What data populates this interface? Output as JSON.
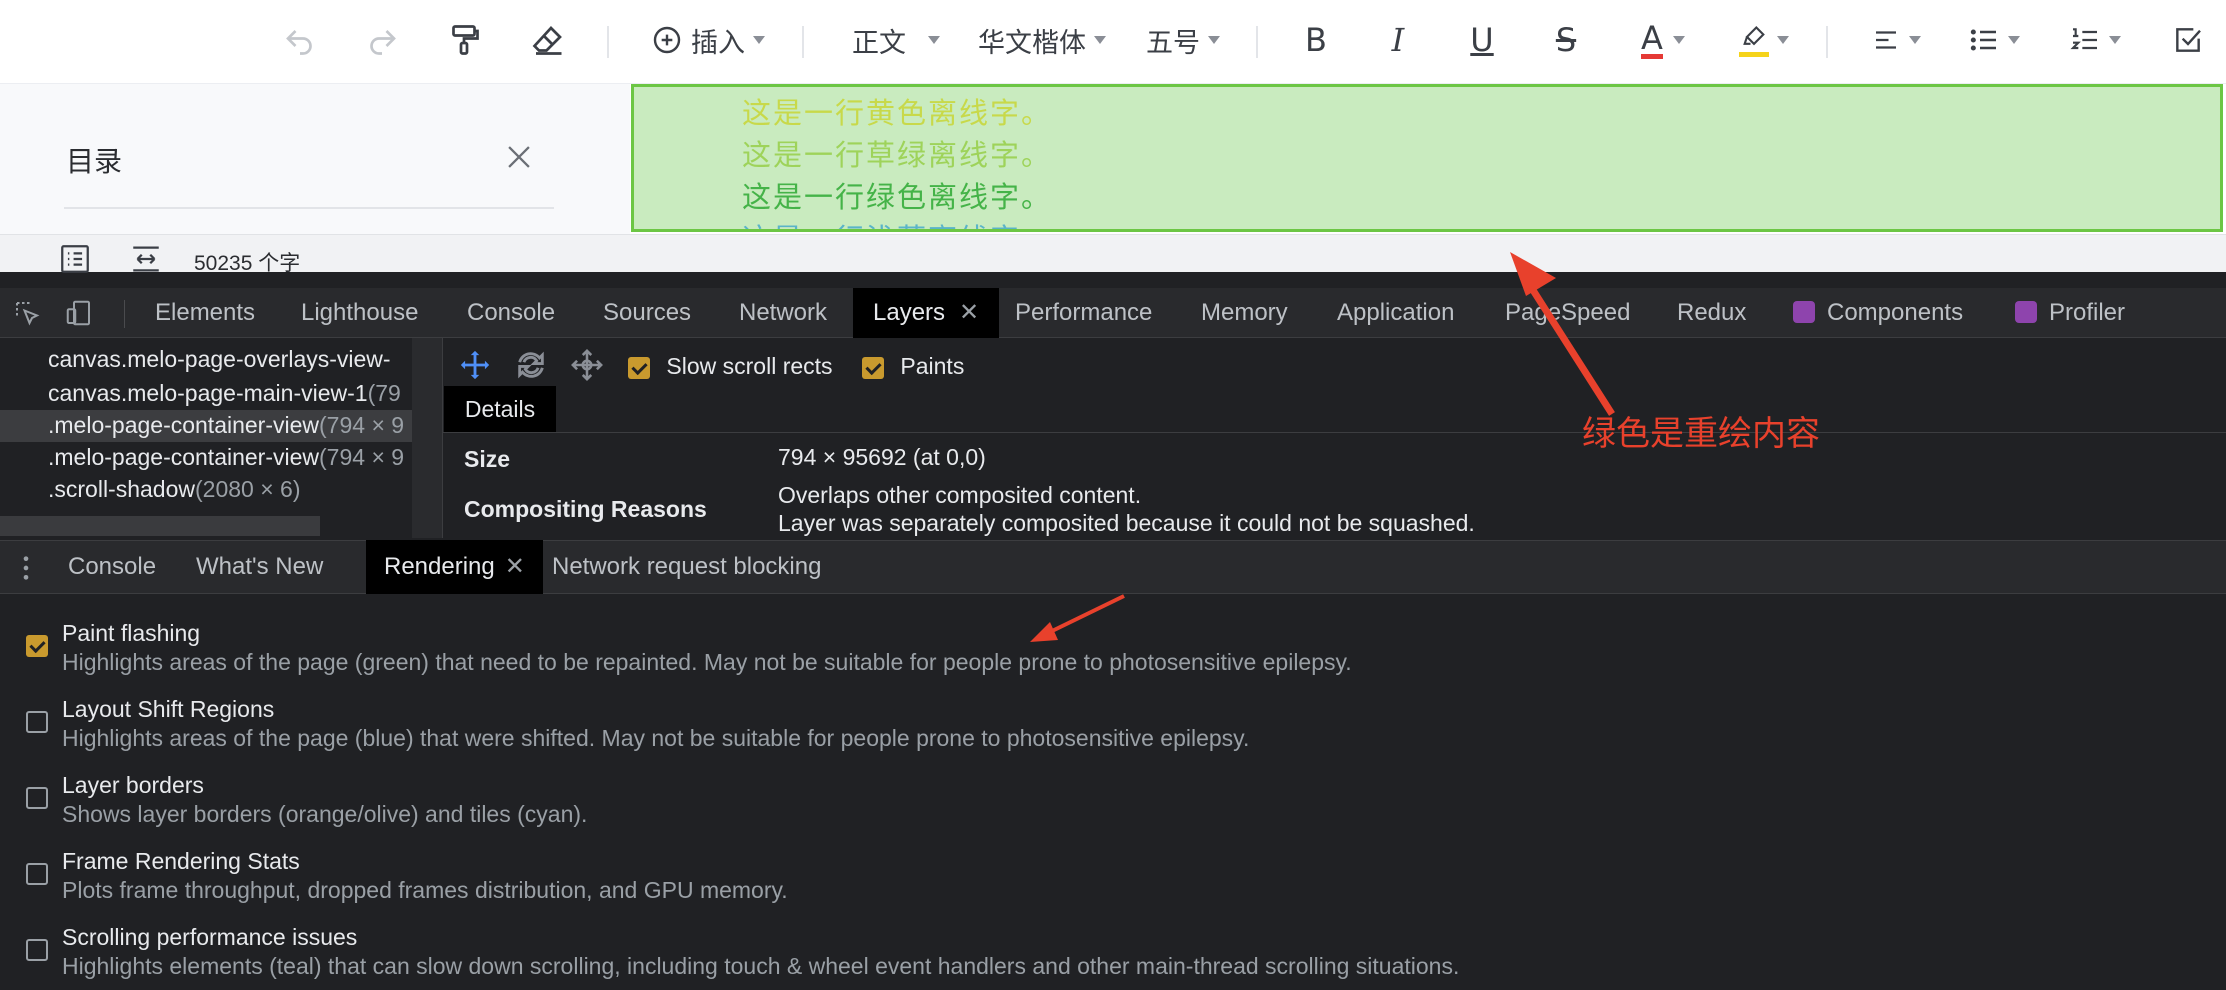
{
  "toolbar": {
    "insert_label": "插入",
    "style_label": "正文",
    "font_label": "华文楷体",
    "size_label": "五号",
    "bold_glyph": "B",
    "italic_glyph": "I",
    "underline_glyph": "U",
    "strike_glyph": "S",
    "font_color_glyph": "A",
    "font_color": "#e53935",
    "highlight_color": "#f5d31a"
  },
  "sidebar": {
    "title": "目录"
  },
  "document": {
    "lines": [
      {
        "text": "这是一行黄色离线字。",
        "color": "#c8d94a"
      },
      {
        "text": "这是一行草绿离线字。",
        "color": "#9ed35a"
      },
      {
        "text": "这是一行绿色离线字。",
        "color": "#45b348"
      },
      {
        "text": "这是一行浅蓝离线字。",
        "color": "#5ab4c8"
      }
    ],
    "paint_flash_color": "#c9ebbf"
  },
  "status": {
    "word_count": "50235 个字"
  },
  "devtools": {
    "tabs": [
      "Elements",
      "Lighthouse",
      "Console",
      "Sources",
      "Network",
      "Layers",
      "Performance",
      "Memory",
      "Application",
      "PageSpeed",
      "Redux",
      "Components",
      "Profiler"
    ],
    "active_tab": "Layers",
    "layers": {
      "tree": [
        {
          "name": "canvas.melo-page-overlays-view-",
          "dim": ""
        },
        {
          "name": "canvas.melo-page-main-view-1",
          "dim": "(79"
        },
        {
          "name": ".melo-page-container-view",
          "dim": "(794 × 9"
        },
        {
          "name": ".melo-page-container-view",
          "dim": "(794 × 9"
        },
        {
          "name": ".scroll-shadow",
          "dim": "(2080 × 6)"
        }
      ],
      "options": [
        {
          "label": "Slow scroll rects",
          "checked": true
        },
        {
          "label": "Paints",
          "checked": true
        }
      ],
      "details_tab": "Details",
      "details": {
        "size_label": "Size",
        "size_value": "794 × 95692 (at 0,0)",
        "reasons_label": "Compositing Reasons",
        "reason_1": "Overlaps other composited content.",
        "reason_2": "Layer was separately composited because it could not be squashed."
      }
    },
    "drawer_tabs": [
      "Console",
      "What's New",
      "Rendering",
      "Network request blocking"
    ],
    "drawer_active": "Rendering",
    "rendering_options": [
      {
        "title": "Paint flashing",
        "desc": "Highlights areas of the page (green) that need to be repainted. May not be suitable for people prone to photosensitive epilepsy.",
        "checked": true
      },
      {
        "title": "Layout Shift Regions",
        "desc": "Highlights areas of the page (blue) that were shifted. May not be suitable for people prone to photosensitive epilepsy.",
        "checked": false
      },
      {
        "title": "Layer borders",
        "desc": "Shows layer borders (orange/olive) and tiles (cyan).",
        "checked": false
      },
      {
        "title": "Frame Rendering Stats",
        "desc": "Plots frame throughput, dropped frames distribution, and GPU memory.",
        "checked": false
      },
      {
        "title": "Scrolling performance issues",
        "desc": "Highlights elements (teal) that can slow down scrolling, including touch & wheel event handlers and other main-thread scrolling situations.",
        "checked": false
      }
    ]
  },
  "annotation": {
    "text": "绿色是重绘内容",
    "color": "#e8412c"
  }
}
